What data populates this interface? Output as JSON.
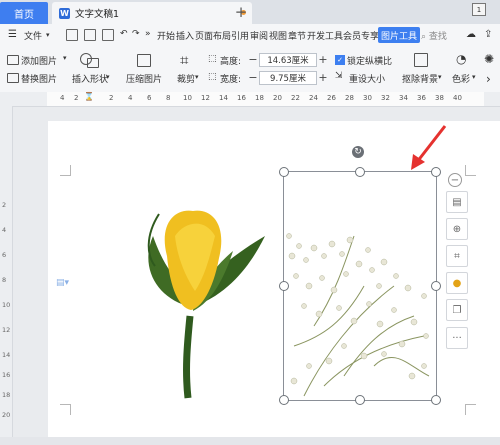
{
  "tabs": {
    "home": "首页",
    "document": "文字文稿1",
    "add_icon": "plus-icon",
    "window_badge": "1"
  },
  "menu": {
    "file": "文件",
    "items": [
      "开始",
      "插入",
      "页面布局",
      "引用",
      "审阅",
      "视图",
      "章节",
      "开发工具",
      "会员专享"
    ],
    "active": "图片工具",
    "search": "查找"
  },
  "ribbon": {
    "add_picture": "添加图片",
    "replace_picture": "替换图片",
    "insert_shape": "插入形状",
    "compress_picture": "压缩图片",
    "crop": "裁剪",
    "height_label": "高度:",
    "height_value": "14.63厘米",
    "width_label": "宽度:",
    "width_value": "9.75厘米",
    "lock_ratio": "锁定纵横比",
    "reset_size": "重设大小",
    "remove_background": "抠除背景",
    "color": "色彩"
  },
  "ruler": {
    "numbers": [
      "4",
      "2",
      "2",
      "4",
      "6",
      "8",
      "10",
      "12",
      "14",
      "16",
      "18",
      "20",
      "22",
      "24",
      "26",
      "28",
      "30",
      "32",
      "34",
      "36",
      "38",
      "40"
    ]
  },
  "vruler": {
    "numbers": [
      "2",
      "4",
      "6",
      "8",
      "10",
      "12",
      "14",
      "16",
      "18",
      "20"
    ]
  },
  "side_toolbar": [
    "layout-icon",
    "zoom-icon",
    "crop-icon",
    "idea-icon",
    "copy-icon",
    "more-icon"
  ],
  "colors": {
    "accent": "#3d7ff0",
    "red_arrow": "#e5322f"
  }
}
